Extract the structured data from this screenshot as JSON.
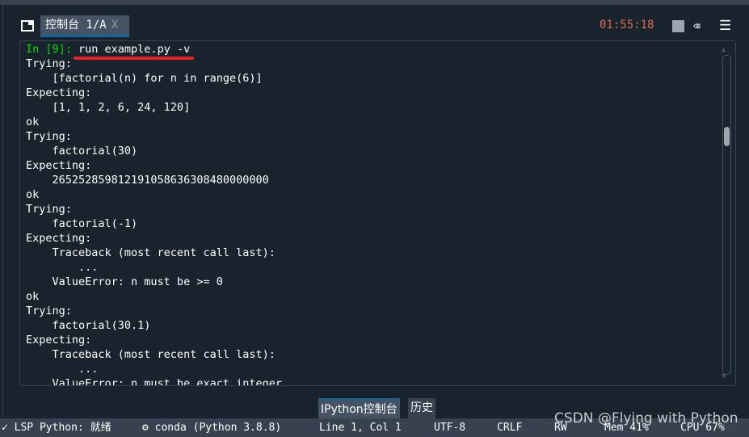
{
  "header": {
    "tab_label": "控制台 1/A",
    "close": "X",
    "time": "01:55:18"
  },
  "console": {
    "prompt": "In [9]:",
    "command": " run example.py -v",
    "lines": [
      "Trying:",
      "    [factorial(n) for n in range(6)]",
      "Expecting:",
      "    [1, 1, 2, 6, 24, 120]",
      "ok",
      "Trying:",
      "    factorial(30)",
      "Expecting:",
      "    265252859812191058636308480000000",
      "ok",
      "Trying:",
      "    factorial(-1)",
      "Expecting:",
      "    Traceback (most recent call last):",
      "        ...",
      "    ValueError: n must be >= 0",
      "ok",
      "Trying:",
      "    factorial(30.1)",
      "Expecting:",
      "    Traceback (most recent call last):",
      "        ...",
      "    ValueError: n must be exact integer"
    ],
    "scroll_position_percent": 22
  },
  "bottom_tabs": [
    "IPython控制台",
    "历史"
  ],
  "status": {
    "lsp": "LSP Python: 就绪",
    "env": "conda (Python 3.8.8)",
    "pos": "Line 1, Col 1",
    "enc": "UTF-8",
    "eol": "CRLF",
    "mode": "RW",
    "mem": "Mem 41%",
    "cpu": "CPU 67%"
  },
  "watermark": "CSDN @Flying with Python"
}
